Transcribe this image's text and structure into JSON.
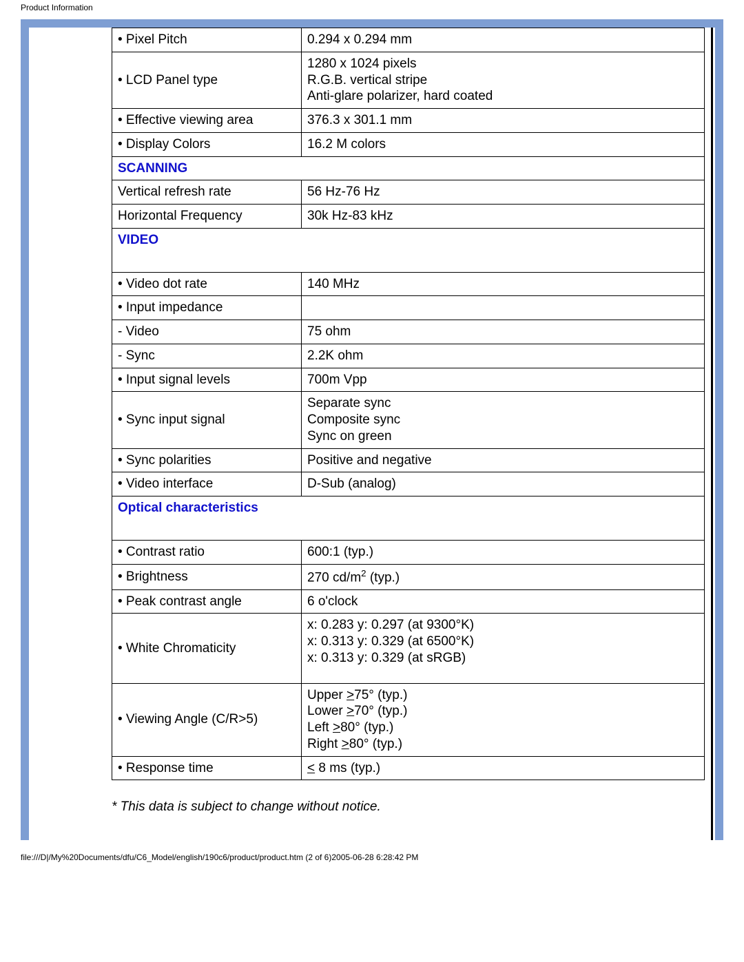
{
  "header_title": "Product Information",
  "footer_path": "file:///D|/My%20Documents/dfu/C6_Model/english/190c6/product/product.htm (2 of 6)2005-06-28 6:28:42 PM",
  "footnote": "* This data is subject to change without notice.",
  "rows": {
    "pixel_pitch_label": "• Pixel Pitch",
    "pixel_pitch_value": "0.294 x 0.294 mm",
    "lcd_panel_label": "• LCD Panel type",
    "lcd_panel_value": "1280 x 1024 pixels\nR.G.B. vertical stripe\nAnti-glare polarizer, hard coated",
    "effective_area_label": "• Effective viewing area",
    "effective_area_value": "376.3 x 301.1 mm",
    "display_colors_label": "• Display Colors",
    "display_colors_value": "16.2 M colors",
    "scanning_header": "SCANNING",
    "vert_refresh_label": "Vertical refresh rate",
    "vert_refresh_value": "56 Hz-76 Hz",
    "horiz_freq_label": "Horizontal Frequency",
    "horiz_freq_value": "30k Hz-83 kHz",
    "video_header": "VIDEO",
    "video_dot_label": "• Video dot rate",
    "video_dot_value": "140 MHz",
    "input_imp_label": "• Input impedance",
    "input_imp_value": "",
    "imp_video_label": "- Video",
    "imp_video_value": "75 ohm",
    "imp_sync_label": "- Sync",
    "imp_sync_value": "2.2K ohm",
    "input_sig_label": "• Input signal levels",
    "input_sig_value": "700m Vpp",
    "sync_input_label": "• Sync input signal",
    "sync_input_value": "Separate sync\nComposite sync\nSync on green",
    "sync_pol_label": "• Sync polarities",
    "sync_pol_value": "Positive and negative",
    "video_if_label": "• Video interface",
    "video_if_value": "D-Sub (analog)",
    "optical_header": "Optical characteristics",
    "contrast_label": "• Contrast ratio",
    "contrast_value": "600:1 (typ.)",
    "brightness_label": "• Brightness",
    "brightness_value_pre": "270 cd/m",
    "brightness_value_sup": "2",
    "brightness_value_post": " (typ.)",
    "peak_angle_label": "• Peak contrast angle",
    "peak_angle_value": "6 o'clock",
    "white_chrom_label": "• White Chromaticity",
    "white_chrom_value": "x: 0.283 y: 0.297 (at 9300°K)\nx: 0.313 y: 0.329 (at 6500°K)\nx: 0.313 y: 0.329 (at sRGB)",
    "view_angle_label": "• Viewing Angle (C/R>5)",
    "view_angle_upper_pre": "Upper ",
    "view_angle_upper_u": ">",
    "view_angle_upper_post": "75° (typ.)",
    "view_angle_lower_pre": "Lower ",
    "view_angle_lower_u": ">",
    "view_angle_lower_post": "70° (typ.)",
    "view_angle_left_pre": "Left ",
    "view_angle_left_u": ">",
    "view_angle_left_post": "80° (typ.)",
    "view_angle_right_pre": "Right ",
    "view_angle_right_u": ">",
    "view_angle_right_post": "80° (typ.)",
    "response_label": "• Response time",
    "response_u": "<",
    "response_post": " 8 ms (typ.)"
  }
}
